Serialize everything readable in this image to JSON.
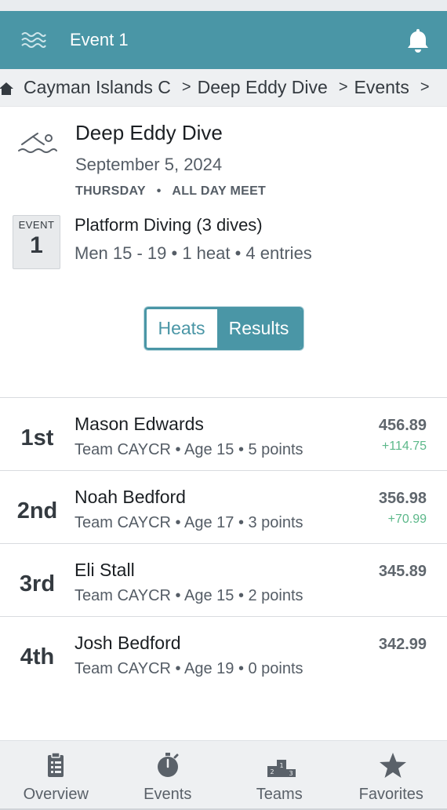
{
  "header": {
    "title": "Event 1",
    "menu_icon": "waves-icon",
    "notification_icon": "bell-icon",
    "accent_color": "#4a96a6"
  },
  "breadcrumb": {
    "home_icon": "home-icon",
    "items": [
      "Cayman Islands C",
      "Deep Eddy Dive",
      "Events"
    ]
  },
  "meet": {
    "icon": "swimmer-icon",
    "name": "Deep Eddy Dive",
    "date": "September 5, 2024",
    "day": "THURSDAY",
    "session": "ALL DAY MEET",
    "separator": "•"
  },
  "event": {
    "badge_label": "EVENT",
    "badge_number": "1",
    "name": "Platform Diving (3 dives)",
    "meta": "Men 15 - 19 • 1 heat • 4 entries"
  },
  "toggle": {
    "heats": "Heats",
    "results": "Results",
    "selected": "Results"
  },
  "results": [
    {
      "place": "1st",
      "name": "Mason Edwards",
      "meta": "Team CAYCR • Age 15 • 5 points",
      "score": "456.89",
      "delta": "+114.75"
    },
    {
      "place": "2nd",
      "name": "Noah Bedford",
      "meta": "Team CAYCR • Age 17 • 3 points",
      "score": "356.98",
      "delta": "+70.99"
    },
    {
      "place": "3rd",
      "name": "Eli Stall",
      "meta": "Team CAYCR • Age 15 • 2 points",
      "score": "345.89",
      "delta": ""
    },
    {
      "place": "4th",
      "name": "Josh Bedford",
      "meta": "Team CAYCR • Age 19 • 0 points",
      "score": "342.99",
      "delta": ""
    }
  ],
  "tabbar": [
    {
      "label": "Overview",
      "icon": "clipboard-icon"
    },
    {
      "label": "Events",
      "icon": "stopwatch-icon"
    },
    {
      "label": "Teams",
      "icon": "podium-icon"
    },
    {
      "label": "Favorites",
      "icon": "star-icon"
    }
  ]
}
